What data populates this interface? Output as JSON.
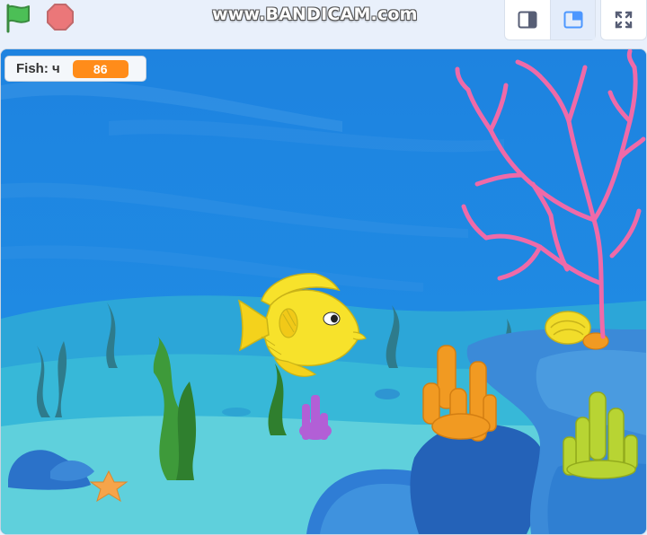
{
  "watermark": "www.BANDICAM.com",
  "controls": {
    "green_flag_icon": "green-flag-icon",
    "stop_icon": "stop-sign-icon",
    "small_stage_icon": "small-stage-icon",
    "normal_stage_icon": "normal-stage-icon",
    "fullscreen_icon": "fullscreen-icon"
  },
  "monitor": {
    "label": "Fish: ч",
    "value": "86"
  },
  "colors": {
    "accent": "#ff8c1a",
    "flag_green": "#4cbf56",
    "stop_red": "#ec5959",
    "water": "#1e84e0",
    "coral_pink": "#ef6aa8",
    "fish_yellow": "#f7e22b"
  }
}
